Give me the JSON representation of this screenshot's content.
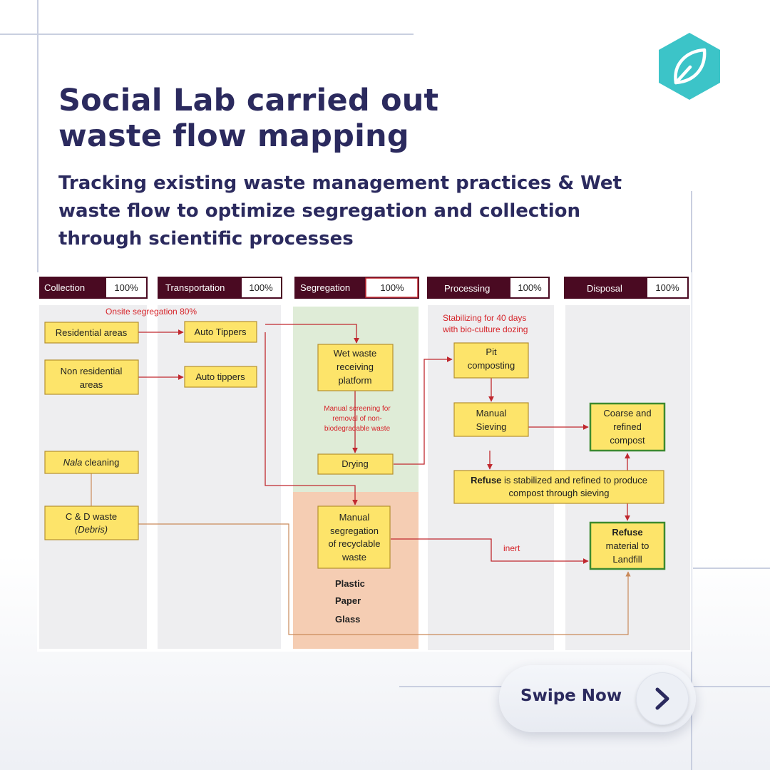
{
  "header": {
    "title_line1": "Social Lab carried out",
    "title_line2": "waste flow mapping",
    "subtitle": "Tracking existing waste management practices & Wet waste flow to optimize segregation and collection through scientific processes"
  },
  "brand": {
    "logo_icon": "leaf-hexagon-icon",
    "accent_color": "#3cc4c8"
  },
  "diagram": {
    "stages": [
      {
        "label": "Collection",
        "value": "100%"
      },
      {
        "label": "Transportation",
        "value": "100%"
      },
      {
        "label": "Segregation",
        "value": "100%"
      },
      {
        "label": "Processing",
        "value": "100%"
      },
      {
        "label": "Disposal",
        "value": "100%"
      }
    ],
    "annotations": {
      "onsite": "Onsite segregation 80%",
      "stabilizing_1": "Stabilizing for 40 days",
      "stabilizing_2": "with bio-culture dozing",
      "screening_1": "Manual screening for",
      "screening_2": "removal of non-",
      "screening_3": "biodegradable waste",
      "inert": "inert"
    },
    "boxes": {
      "residential": "Residential areas",
      "nonres_1": "Non residential",
      "nonres_2": "areas",
      "auto1": "Auto Tippers",
      "auto2": "Auto tippers",
      "nala_1": "Nala",
      "nala_2": " cleaning",
      "cd_1": "C & D waste",
      "cd_2": "(Debris)",
      "wet_1": "Wet waste",
      "wet_2": "receiving",
      "wet_3": "platform",
      "drying": "Drying",
      "manseg_1": "Manual",
      "manseg_2": "segregation",
      "manseg_3": "of recyclable",
      "manseg_4": "waste",
      "pit_1": "Pit",
      "pit_2": "composting",
      "sieve_1": "Manual",
      "sieve_2": "Sieving",
      "coarse_1": "Coarse and",
      "coarse_2": "refined",
      "coarse_3": "compost",
      "refuse_bold": "Refuse",
      "refuse_rest": " is stabilized and refined to produce",
      "refuse_2": "compost through sieving",
      "landfill_1": "Refuse",
      "landfill_2": "material to",
      "landfill_3": "Landfill"
    },
    "recyclables": [
      "Plastic",
      "Paper",
      "Glass"
    ]
  },
  "cta": {
    "label": "Swipe Now",
    "icon": "chevron-right-icon"
  }
}
